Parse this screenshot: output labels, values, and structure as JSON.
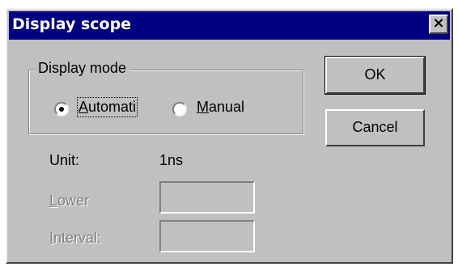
{
  "window": {
    "title": "Display scope",
    "close_glyph": "×"
  },
  "display_mode": {
    "legend": "Display mode",
    "automatic_label_rest": "utomati",
    "automatic_label_accel": "A",
    "manual_label_accel": "M",
    "manual_label_rest": "anual",
    "selected": "automatic"
  },
  "buttons": {
    "ok_label": "OK",
    "cancel_label": "Cancel"
  },
  "unit": {
    "label": "Unit:",
    "value": "1ns"
  },
  "lower": {
    "label_accel": "L",
    "label_rest": "ower",
    "value": ""
  },
  "interval": {
    "label_accel": "I",
    "label_rest": "nterval:",
    "value": ""
  },
  "colors": {
    "dialog_face": "#c0c0c0",
    "titlebar": "#000080",
    "disabled_text": "#808080"
  }
}
